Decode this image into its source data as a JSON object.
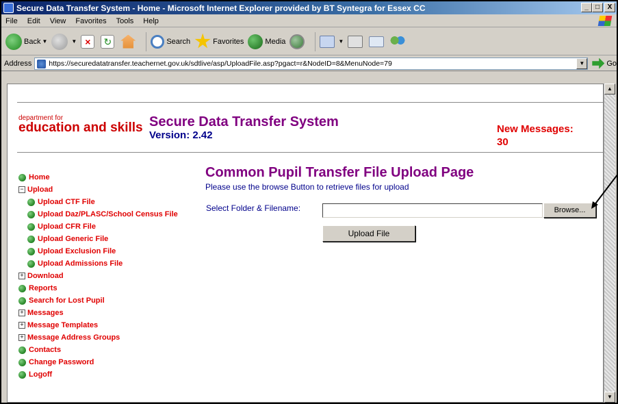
{
  "window": {
    "title": "Secure Data Transfer System - Home - Microsoft Internet Explorer provided by BT Syntegra for Essex CC",
    "buttons": [
      "_",
      "□",
      "X"
    ]
  },
  "menubar": [
    "File",
    "Edit",
    "View",
    "Favorites",
    "Tools",
    "Help"
  ],
  "toolbar": {
    "back": "Back",
    "search": "Search",
    "favorites": "Favorites",
    "media": "Media"
  },
  "address": {
    "label": "Address",
    "url": "https://securedatatransfer.teachernet.gov.uk/sdtlive/asp/UploadFile.asp?pgact=r&NodeID=8&MenuNode=79",
    "go": "Go"
  },
  "header": {
    "logo_small": "department for",
    "logo_big": "education and skills",
    "system_title": "Secure Data Transfer System",
    "version": "Version: 2.42",
    "new_messages_label": "New Messages:",
    "new_messages_count": "30"
  },
  "nav": [
    {
      "label": "Home",
      "marker": "dot",
      "sub": false
    },
    {
      "label": "Upload",
      "marker": "minus",
      "sub": false
    },
    {
      "label": "Upload CTF File",
      "marker": "dot",
      "sub": true
    },
    {
      "label": "Upload Daz/PLASC/School Census File",
      "marker": "dot",
      "sub": true
    },
    {
      "label": "Upload CFR File",
      "marker": "dot",
      "sub": true
    },
    {
      "label": "Upload Generic File",
      "marker": "dot",
      "sub": true
    },
    {
      "label": "Upload Exclusion File",
      "marker": "dot",
      "sub": true
    },
    {
      "label": "Upload Admissions File",
      "marker": "dot",
      "sub": true
    },
    {
      "label": "Download",
      "marker": "plus",
      "sub": false
    },
    {
      "label": "Reports",
      "marker": "dot",
      "sub": false
    },
    {
      "label": "Search for Lost Pupil",
      "marker": "dot",
      "sub": false
    },
    {
      "label": "Messages",
      "marker": "plus",
      "sub": false
    },
    {
      "label": "Message Templates",
      "marker": "plus",
      "sub": false
    },
    {
      "label": "Message Address Groups",
      "marker": "plus",
      "sub": false
    },
    {
      "label": "Contacts",
      "marker": "dot",
      "sub": false
    },
    {
      "label": "Change Password",
      "marker": "dot",
      "sub": false
    },
    {
      "label": "Logoff",
      "marker": "dot",
      "sub": false
    }
  ],
  "main": {
    "heading": "Common Pupil Transfer File Upload Page",
    "instructions": "Please use the browse Button to retrieve files for upload",
    "field_label": "Select Folder & Filename:",
    "file_value": "",
    "browse_label": "Browse...",
    "upload_label": "Upload File"
  },
  "colors": {
    "nav_red": "#e00000",
    "title_purple": "#800080",
    "version_navy": "#00008b",
    "link_green": "#006400"
  }
}
